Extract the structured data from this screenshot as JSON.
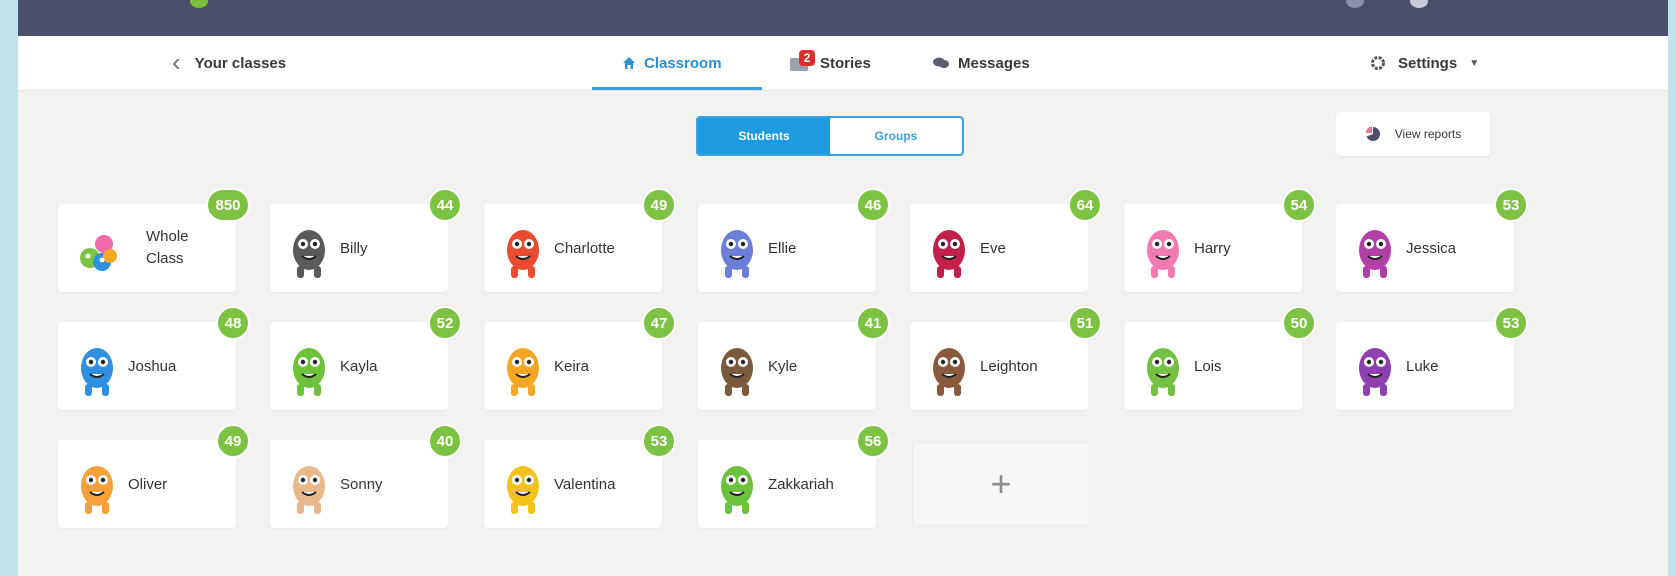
{
  "nav": {
    "back_label": "Your classes",
    "tabs": [
      {
        "label": "Classroom",
        "icon": "home-icon",
        "active": true
      },
      {
        "label": "Stories",
        "icon": "stories-icon",
        "badge": "2"
      },
      {
        "label": "Messages",
        "icon": "messages-icon"
      }
    ],
    "settings_label": "Settings"
  },
  "view_toggle": {
    "students_label": "Students",
    "groups_label": "Groups",
    "selected": "Students"
  },
  "reports_label": "View reports",
  "whole_class": {
    "name_line1": "Whole",
    "name_line2": "Class",
    "points": "850"
  },
  "students": [
    {
      "name": "Billy",
      "points": "44",
      "color": "#5a5a5a"
    },
    {
      "name": "Charlotte",
      "points": "49",
      "color": "#e94b2f"
    },
    {
      "name": "Ellie",
      "points": "46",
      "color": "#6b7fd8"
    },
    {
      "name": "Eve",
      "points": "64",
      "color": "#c2204a"
    },
    {
      "name": "Harry",
      "points": "54",
      "color": "#f17ab0"
    },
    {
      "name": "Jessica",
      "points": "53",
      "color": "#b13fa6"
    },
    {
      "name": "Joshua",
      "points": "48",
      "color": "#2f8fe0"
    },
    {
      "name": "Kayla",
      "points": "52",
      "color": "#6cc23a"
    },
    {
      "name": "Keira",
      "points": "47",
      "color": "#f5a623"
    },
    {
      "name": "Kyle",
      "points": "41",
      "color": "#7a5a3a"
    },
    {
      "name": "Leighton",
      "points": "51",
      "color": "#8a5a3f"
    },
    {
      "name": "Lois",
      "points": "50",
      "color": "#73c043"
    },
    {
      "name": "Luke",
      "points": "53",
      "color": "#8e3fb0"
    },
    {
      "name": "Oliver",
      "points": "49",
      "color": "#f5a03a"
    },
    {
      "name": "Sonny",
      "points": "40",
      "color": "#e7b98a"
    },
    {
      "name": "Valentina",
      "points": "53",
      "color": "#f3c21c"
    },
    {
      "name": "Zakkariah",
      "points": "56",
      "color": "#6cc23a"
    }
  ],
  "add_student_label": "+"
}
